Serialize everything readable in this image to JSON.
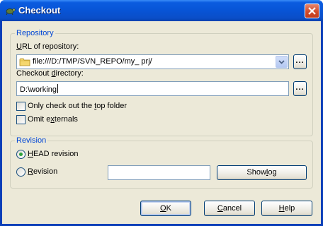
{
  "window": {
    "title": "Checkout",
    "icons": {
      "app": "tortoise-icon",
      "close": "close-icon"
    }
  },
  "repository": {
    "group_label": "Repository",
    "url_label_mnemonic": "U",
    "url_label_rest": "RL of repository:",
    "url_value": "file:///D:/TMP/SVN_REPO/my_ prj/",
    "url_browse": "...",
    "dir_label_prefix": "Checkout ",
    "dir_label_mnemonic": "d",
    "dir_label_rest": "irectory:",
    "dir_value": "D:\\working",
    "dir_browse": "...",
    "top_folder_prefix": "Only check out the ",
    "top_folder_mnemonic": "t",
    "top_folder_rest": "op folder",
    "top_folder_checked": false,
    "omit_prefix": "Omit e",
    "omit_mnemonic": "x",
    "omit_rest": "ternals",
    "omit_checked": false
  },
  "revision": {
    "group_label": "Revision",
    "head_mnemonic": "H",
    "head_rest": "EAD revision",
    "head_selected": true,
    "rev_mnemonic": "R",
    "rev_rest": "evision",
    "rev_selected": false,
    "rev_value": "",
    "show_log_prefix": "Show ",
    "show_log_mnemonic": "l",
    "show_log_rest": "og"
  },
  "buttons": {
    "ok_mnemonic": "O",
    "ok_rest": "K",
    "cancel_mnemonic": "C",
    "cancel_rest": "ancel",
    "help_mnemonic": "H",
    "help_rest": "elp"
  },
  "colors": {
    "accent": "#0046d5",
    "titlebar": "#0754d6",
    "close": "#d24b2a",
    "dialog_bg": "#ece9d8"
  }
}
